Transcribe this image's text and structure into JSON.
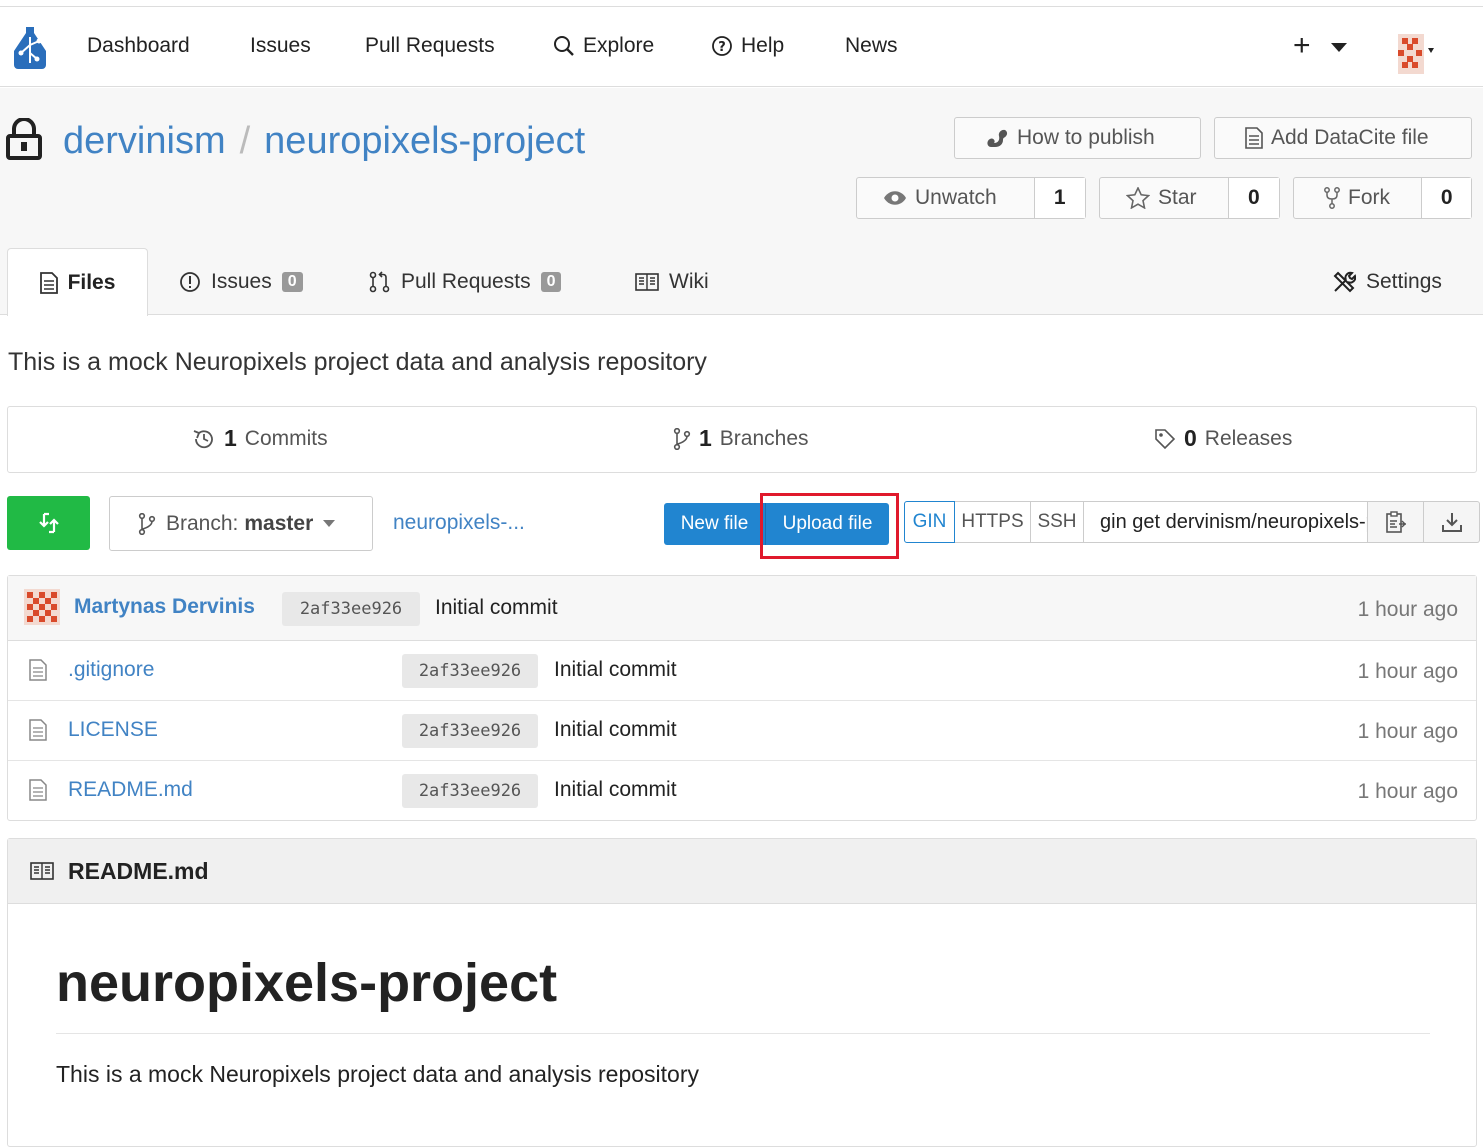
{
  "nav": {
    "items": [
      "Dashboard",
      "Issues",
      "Pull Requests",
      "Explore",
      "Help",
      "News"
    ],
    "plus": "+"
  },
  "repo": {
    "owner": "dervinism",
    "separator": "/",
    "name": "neuropixels-project",
    "how_to_publish": "How to publish",
    "add_datacite": "Add DataCite file",
    "unwatch": "Unwatch",
    "watch_count": "1",
    "star": "Star",
    "star_count": "0",
    "fork": "Fork",
    "fork_count": "0"
  },
  "tabs": {
    "files": "Files",
    "issues": "Issues",
    "issues_count": "0",
    "pulls": "Pull Requests",
    "pulls_count": "0",
    "wiki": "Wiki",
    "settings": "Settings"
  },
  "description": "This is a mock Neuropixels project data and analysis repository",
  "stats": {
    "commits_count": "1",
    "commits_label": "Commits",
    "branches_count": "1",
    "branches_label": "Branches",
    "releases_count": "0",
    "releases_label": "Releases"
  },
  "toolbar": {
    "branch_prefix": "Branch:",
    "branch_name": "master",
    "breadcrumb": "neuropixels-...",
    "new_file": "New file",
    "upload_file": "Upload file",
    "clone_gin": "GIN",
    "clone_https": "HTTPS",
    "clone_ssh": "SSH",
    "clone_url": "gin get dervinism/neuropixels-project"
  },
  "latest_commit": {
    "author": "Martynas Dervinis",
    "sha": "2af33ee926",
    "message": "Initial commit",
    "age": "1 hour ago"
  },
  "files": [
    {
      "name": ".gitignore",
      "sha": "2af33ee926",
      "message": "Initial commit",
      "age": "1 hour ago"
    },
    {
      "name": "LICENSE",
      "sha": "2af33ee926",
      "message": "Initial commit",
      "age": "1 hour ago"
    },
    {
      "name": "README.md",
      "sha": "2af33ee926",
      "message": "Initial commit",
      "age": "1 hour ago"
    }
  ],
  "readme": {
    "filename": "README.md",
    "heading": "neuropixels-project",
    "body": "This is a mock Neuropixels project data and analysis repository"
  },
  "colors": {
    "link": "#4183c4",
    "primary": "#2185d0",
    "green": "#21ba45",
    "highlight": "#e0192c"
  }
}
